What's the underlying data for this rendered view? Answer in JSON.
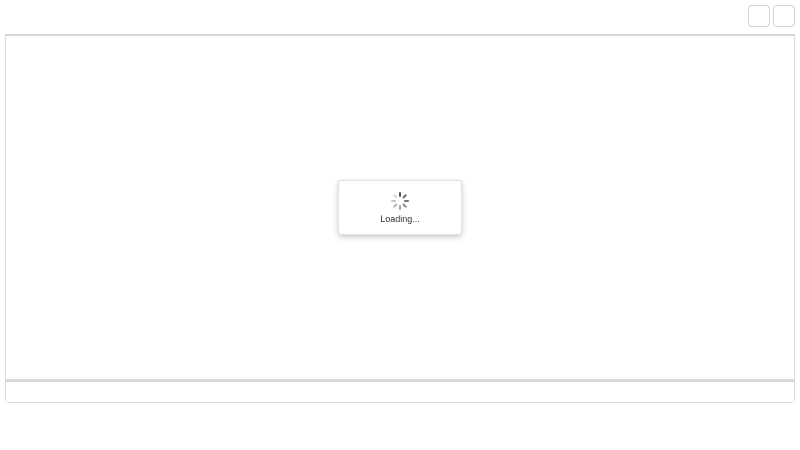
{
  "toolbar": {
    "buttons": [
      {
        "icon": "blank-button-icon"
      },
      {
        "icon": "blank-button-icon"
      }
    ]
  },
  "loading": {
    "text": "Loading...",
    "icon": "spinner-icon"
  }
}
